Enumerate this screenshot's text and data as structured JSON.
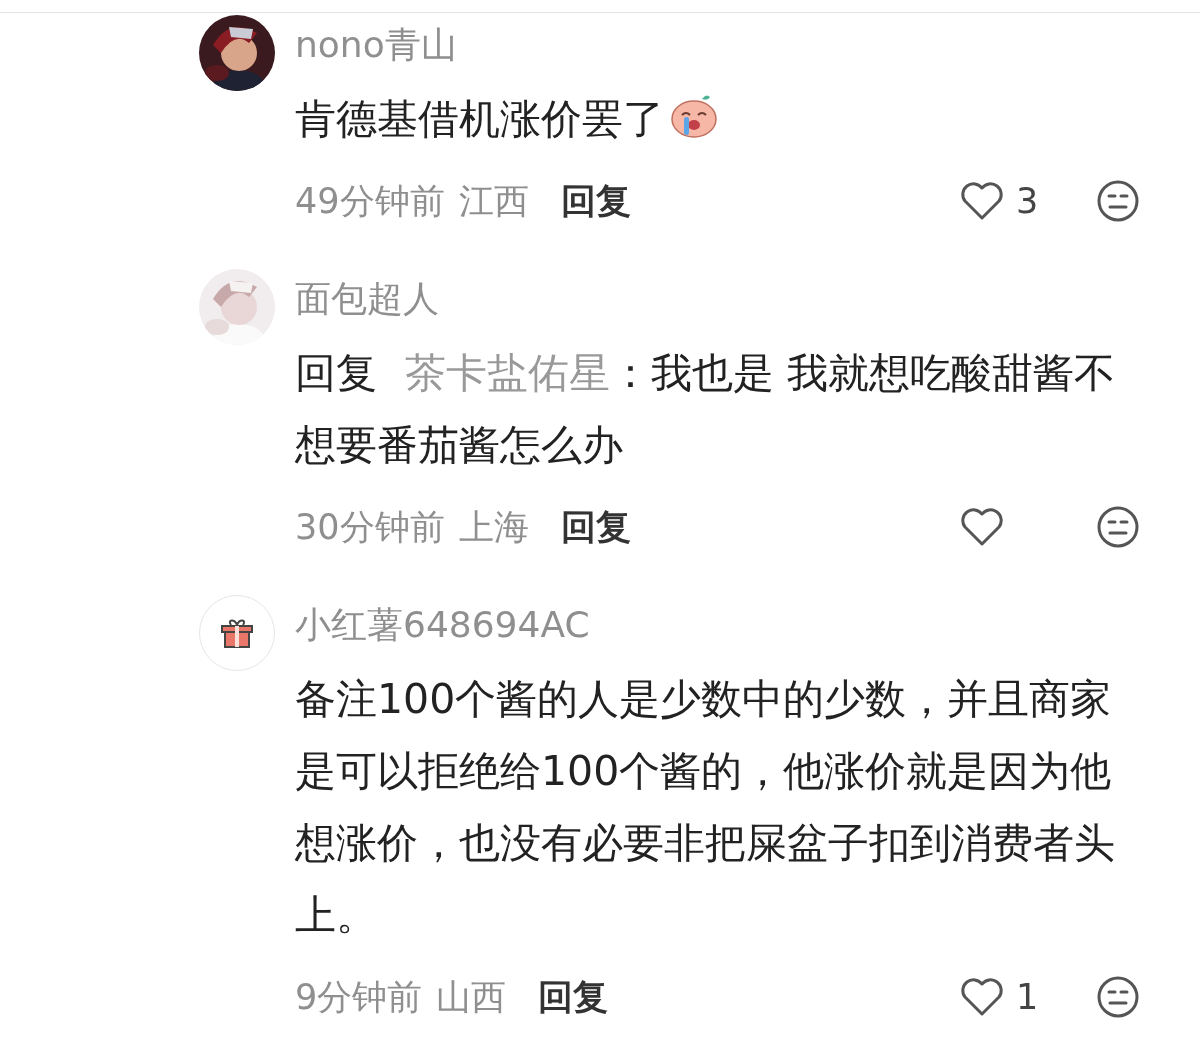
{
  "comments": [
    {
      "name": "nono青山",
      "text": "肯德基借机涨价罢了",
      "emoji": true,
      "time": "49分钟前",
      "region": "江西",
      "reply_button": "回复",
      "like_count": "3"
    },
    {
      "name": "面包超人",
      "reply_to": {
        "label": "回复",
        "target": "茶卡盐佑星"
      },
      "text": "：我也是 我就想吃酸甜酱不想要番茄酱怎么办",
      "time": "30分钟前",
      "region": "上海",
      "reply_button": "回复"
    },
    {
      "avatar": {
        "kind": "gift"
      },
      "name": "小红薯648694AC",
      "text": "备注100个酱的人是少数中的少数，并且商家是可以拒绝给100个酱的，他涨价就是因为他想涨价，也没有必要非把屎盆子扣到消费者头上。",
      "time": "9分钟前",
      "region": "山西",
      "reply_button": "回复",
      "like_count": "1"
    }
  ]
}
